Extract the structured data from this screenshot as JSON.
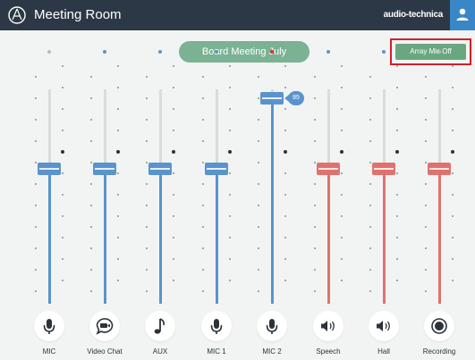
{
  "app": {
    "title": "Meeting Room",
    "brand": "audio-technica"
  },
  "session": {
    "title": "Board Meeting July"
  },
  "array_mic": {
    "label": "Array Mic Off"
  },
  "colors": {
    "topbar": "#2c3845",
    "user_button": "#3a87c8",
    "blue_fader": "#5b93cc",
    "red_fader": "#e0726e",
    "pill_green": "#7bb294",
    "highlight_border": "#d02028"
  },
  "channels": [
    {
      "label": "MIC",
      "icon": "microphone-icon",
      "color": "blue",
      "level": 0.63,
      "indicator": "gray"
    },
    {
      "label": "Video Chat",
      "icon": "video-chat-icon",
      "color": "blue",
      "level": 0.63,
      "indicator": "blue"
    },
    {
      "label": "AUX",
      "icon": "music-note-icon",
      "color": "blue",
      "level": 0.63,
      "indicator": "blue"
    },
    {
      "label": "MIC 1",
      "icon": "microphone-icon",
      "color": "blue",
      "level": 0.63,
      "indicator": "blue"
    },
    {
      "label": "MIC 2",
      "icon": "microphone-icon",
      "color": "blue",
      "level": 0.96,
      "indicator": "red",
      "value_badge": "85"
    },
    {
      "label": "Speech",
      "icon": "speaker-icon",
      "color": "red",
      "level": 0.63,
      "indicator": "blue"
    },
    {
      "label": "Hall",
      "icon": "speaker-icon",
      "color": "red",
      "level": 0.63,
      "indicator": "blue"
    },
    {
      "label": "Recording",
      "icon": "record-icon",
      "color": "red",
      "level": 0.63,
      "indicator": "gray"
    }
  ]
}
